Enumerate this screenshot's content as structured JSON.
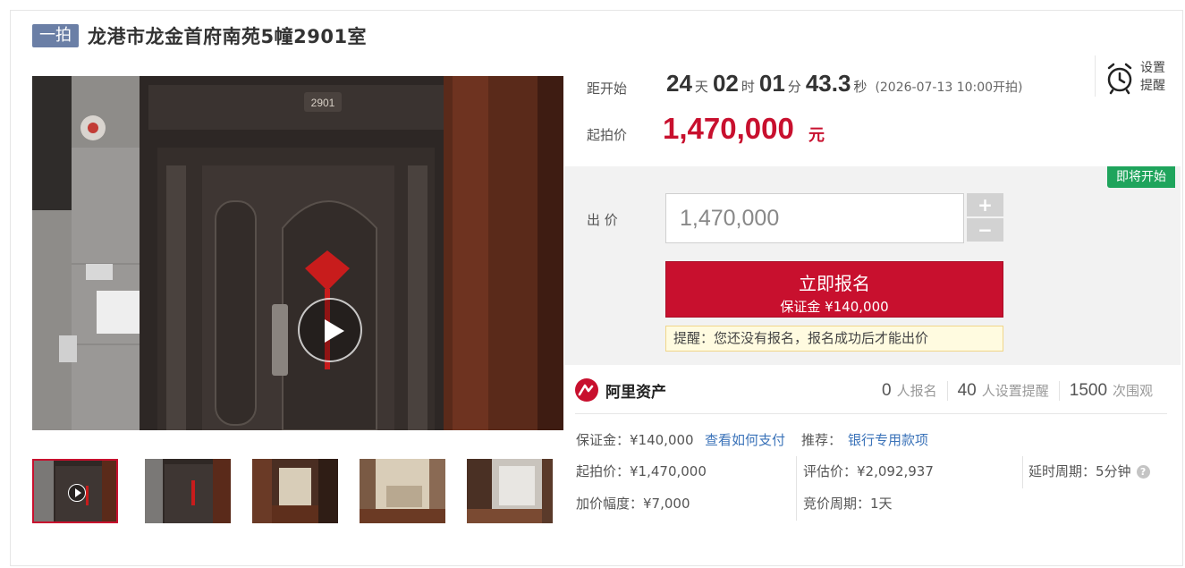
{
  "title": {
    "tag": "一拍",
    "text": "龙港市龙金首府南苑5幢2901室"
  },
  "media": {
    "door_number": "2901",
    "thumbnails": [
      {
        "alt": "door-video",
        "video": true
      },
      {
        "alt": "door-photo"
      },
      {
        "alt": "hallway-photo"
      },
      {
        "alt": "bedroom-photo"
      },
      {
        "alt": "balcony-photo"
      }
    ]
  },
  "countdown": {
    "label": "距开始",
    "days": "24",
    "days_unit": "天",
    "hours": "02",
    "hours_unit": "时",
    "minutes": "01",
    "minutes_unit": "分",
    "seconds": "43.3",
    "seconds_unit": "秒",
    "start_note": "(2026-07-13 10:00开拍)"
  },
  "reminder": {
    "line1": "设置",
    "line2": "提醒",
    "icon": "alarm-clock-icon"
  },
  "start_price": {
    "label": "起拍价",
    "value": "1,470,000",
    "unit": "元"
  },
  "bid": {
    "status_badge": "即将开始",
    "label": "出 价",
    "input_value": "1,470,000",
    "plus": "+",
    "minus": "−",
    "signup_label": "立即报名",
    "deposit_label": "保证金 ¥140,000",
    "notice": "提醒：您还没有报名，报名成功后才能出价"
  },
  "platform": {
    "name": "阿里资产"
  },
  "stats": [
    {
      "num": "0",
      "label": "人报名"
    },
    {
      "num": "40",
      "label": "人设置提醒"
    },
    {
      "num": "1500",
      "label": "次围观"
    }
  ],
  "details": {
    "deposit": "保证金：¥140,000",
    "how_to_pay": "查看如何支付",
    "recommend_label": "推荐：",
    "recommend_link": "银行专用款项",
    "start_price": "起拍价：¥1,470,000",
    "appraisal": "评估价：¥2,092,937",
    "delay_period": "延时周期：5分钟",
    "increment": "加价幅度：¥7,000",
    "bid_period": "竞价周期：1天"
  },
  "colors": {
    "accent_red": "#c8102e",
    "green_badge": "#1fa45c",
    "link_blue": "#3b73b9",
    "tag_blue": "#6b7fa6"
  }
}
